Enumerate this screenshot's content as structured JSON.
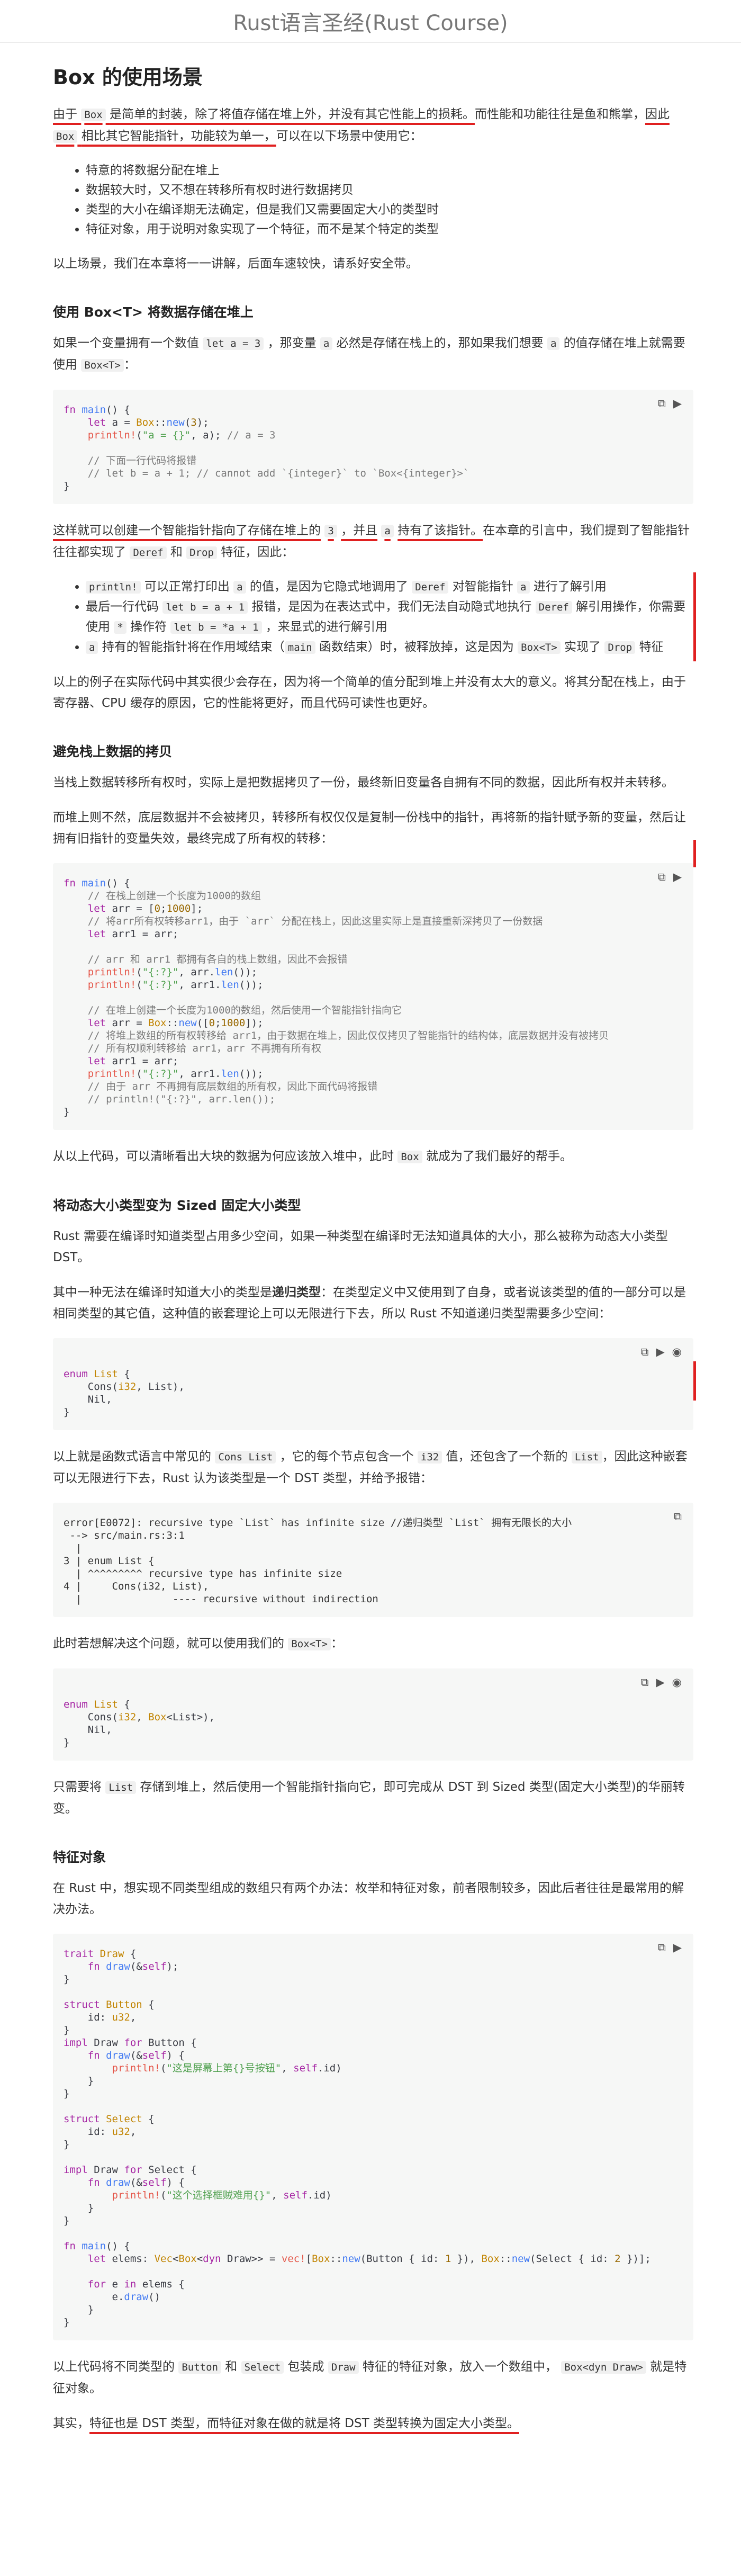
{
  "header": {
    "book_title": "Rust语言圣经(Rust Course)"
  },
  "section": {
    "title": "Box 的使用场景",
    "intro": {
      "p1_a": "由于",
      "p1_code1": "Box",
      "p1_b": "是简单的封装，除了将值存储在堆上外，并没有其它性能上的损耗。",
      "p1_c": "而性能和功能往往是鱼和熊掌，",
      "p1_d": "因此",
      "p1_code2": "Box",
      "p1_e": "相比其它智能指针，功能较为单一，",
      "p1_f": "可以在以下场景中使用它："
    },
    "scenarios": [
      "特意的将数据分配在堆上",
      "数据较大时，又不想在转移所有权时进行数据拷贝",
      "类型的大小在编译期无法确定，但是我们又需要固定大小的类型时",
      "特征对象，用于说明对象实现了一个特征，而不是某个特定的类型"
    ],
    "outro": "以上场景，我们在本章将一一讲解，后面车速较快，请系好安全带。"
  },
  "s1": {
    "title": "使用 Box<T> 将数据存储在堆上",
    "p1_a": "如果一个变量拥有一个数值",
    "p1_code1": "let a = 3",
    "p1_b": "，那变量",
    "p1_code2": "a",
    "p1_c": "必然是存储在栈上的，那如果我们想要",
    "p1_code3": "a",
    "p1_d": "的值存储在堆上就需要使用",
    "p1_code4": "Box<T>",
    "p1_e": "：",
    "p2_a": "这样就可以创建一个智能指针指向了存储在堆上的",
    "p2_code1": "3",
    "p2_b": "，并且",
    "p2_code2": "a",
    "p2_c": "持有了该指针。",
    "p2_d": "在本章的引言中，我们提到了智能指针往往都实现了",
    "p2_code3": "Deref",
    "p2_e": "和",
    "p2_code4": "Drop",
    "p2_f": "特征，因此：",
    "b1_code": "println!",
    "b1_a": "可以正常打印出",
    "b1_code2": "a",
    "b1_b": "的值，是因为它隐式地调用了",
    "b1_code3": "Deref",
    "b1_c": "对智能指针",
    "b1_code4": "a",
    "b1_d": "进行了解引用",
    "b2_a": "最后一行代码",
    "b2_code1": "let b = a + 1",
    "b2_b": "报错，是因为在表达式中，我们无法自动隐式地执行",
    "b2_code2": "Deref",
    "b2_c": "解引用操作，你需要使用",
    "b2_code3": "*",
    "b2_d": "操作符",
    "b2_code4": "let b = *a + 1",
    "b2_e": "，来显式的进行解引用",
    "b3_code1": "a",
    "b3_a": "持有的智能指针将在作用域结束（",
    "b3_code2": "main",
    "b3_b": "函数结束）时，被释放掉，这是因为",
    "b3_code3": "Box<T>",
    "b3_c": "实现了",
    "b3_code4": "Drop",
    "b3_d": "特征",
    "p3": "以上的例子在实际代码中其实很少会存在，因为将一个简单的值分配到堆上并没有太大的意义。将其分配在栈上，由于寄存器、CPU 缓存的原因，它的性能将更好，而且代码可读性也更好。"
  },
  "s2": {
    "title": "避免栈上数据的拷贝",
    "p1": "当栈上数据转移所有权时，实际上是把数据拷贝了一份，最终新旧变量各自拥有不同的数据，因此所有权并未转移。",
    "p2": "而堆上则不然，底层数据并不会被拷贝，转移所有权仅仅是复制一份栈中的指针，再将新的指针赋予新的变量，然后让拥有旧指针的变量失效，最终完成了所有权的转移：",
    "p3_a": "从以上代码，可以清晰看出大块的数据为何应该放入堆中，此时",
    "p3_code": "Box",
    "p3_b": "就成为了我们最好的帮手。"
  },
  "s3": {
    "title": "将动态大小类型变为 Sized 固定大小类型",
    "p1": "Rust 需要在编译时知道类型占用多少空间，如果一种类型在编译时无法知道具体的大小，那么被称为动态大小类型 DST。",
    "p2_a": "其中一种无法在编译时知道大小的类型是",
    "p2_b": "递归类型",
    "p2_c": "：在类型定义中又使用到了自身，或者说该类型的值的一部分可以是相同类型的其它值，这种值的嵌套理论上可以无限进行下去，所以 Rust 不知道递归类型需要多少空间：",
    "p3_a": "以上就是函数式语言中常见的",
    "p3_code1": "Cons List",
    "p3_b": "，它的每个节点包含一个",
    "p3_code2": "i32",
    "p3_c": "值，还包含了一个新的",
    "p3_code3": "List",
    "p3_d": "，因此这种嵌套可以无限进行下去，Rust 认为该类型是一个 DST 类型，并给予报错：",
    "p4_a": "此时若想解决这个问题，就可以使用我们的",
    "p4_code": "Box<T>",
    "p4_b": "：",
    "p5_a": "只需要将",
    "p5_code": "List",
    "p5_b": "存储到堆上，然后使用一个智能指针指向它，即可完成从 DST 到 Sized 类型(固定大小类型)的华丽转变。"
  },
  "s4": {
    "title": "特征对象",
    "p1": "在 Rust 中，想实现不同类型组成的数组只有两个办法：枚举和特征对象，前者限制较多，因此后者往往是最常用的解决办法。",
    "p2_a": "以上代码将不同类型的",
    "p2_code1": "Button",
    "p2_b": "和",
    "p2_code2": "Select",
    "p2_c": "包装成",
    "p2_code3": "Draw",
    "p2_d": "特征的特征对象，放入一个数组中，",
    "p2_code4": "Box<dyn Draw>",
    "p2_e": "就是特征对象。",
    "p3_a": "其实，",
    "p3_b": "特征也是 DST 类型，而特征对象在做的就是将 DST 类型转换为固定大小类型。"
  },
  "code_tools": {
    "copy_icon": "⧉",
    "play_icon": "▶",
    "eye_icon": "◉"
  },
  "colors": {
    "annotation_red": "#e02020",
    "code_bg": "#f6f7f6"
  }
}
